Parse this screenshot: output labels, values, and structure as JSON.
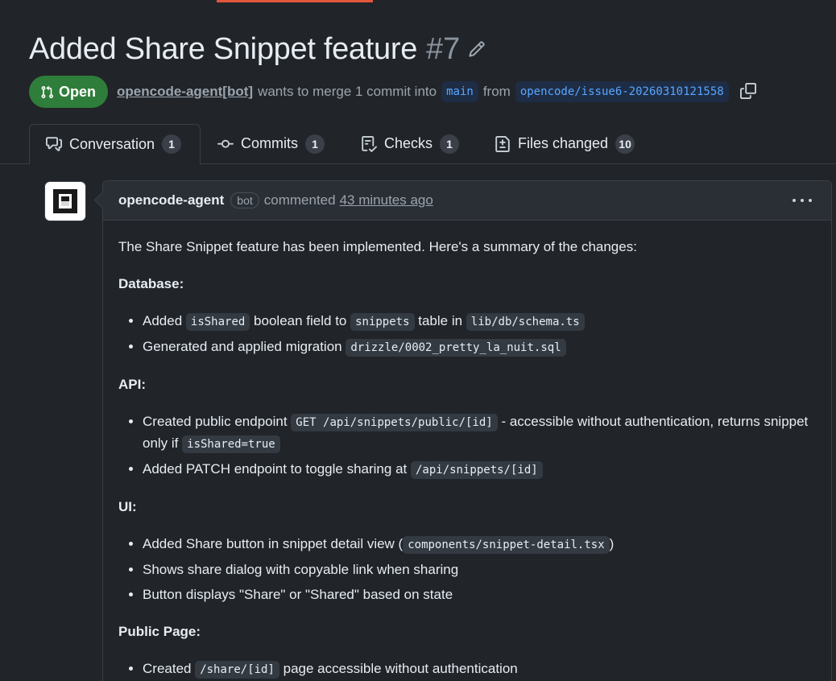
{
  "pr": {
    "title": "Added Share Snippet feature",
    "number": "#7",
    "state": "Open",
    "author": "opencode-agent[bot]",
    "merge_text": "wants to merge 1 commit into",
    "base_branch": "main",
    "from_text": "from",
    "head_branch": "opencode/issue6-20260310121558"
  },
  "tabs": [
    {
      "label": "Conversation",
      "count": "1",
      "icon": "comment-discussion-icon"
    },
    {
      "label": "Commits",
      "count": "1",
      "icon": "git-commit-icon"
    },
    {
      "label": "Checks",
      "count": "1",
      "icon": "checklist-icon"
    },
    {
      "label": "Files changed",
      "count": "10",
      "icon": "file-diff-icon"
    }
  ],
  "comment": {
    "author": "opencode-agent",
    "badge": "bot",
    "verb": "commented",
    "time": "43 minutes ago",
    "intro": "The Share Snippet feature has been implemented. Here's a summary of the changes:",
    "database": {
      "heading": "Database:",
      "item1": {
        "t1": "Added ",
        "c1": "isShared",
        "t2": " boolean field to ",
        "c2": "snippets",
        "t3": " table in ",
        "c3": "lib/db/schema.ts"
      },
      "item2": {
        "t1": "Generated and applied migration ",
        "c1": "drizzle/0002_pretty_la_nuit.sql"
      }
    },
    "api": {
      "heading": "API:",
      "item1": {
        "t1": "Created public endpoint ",
        "c1": "GET /api/snippets/public/[id]",
        "t2": " - accessible without authentication, returns snippet only if ",
        "c2": "isShared=true"
      },
      "item2": {
        "t1": "Added PATCH endpoint to toggle sharing at ",
        "c1": "/api/snippets/[id]"
      }
    },
    "ui": {
      "heading": "UI:",
      "item1": {
        "t1": "Added Share button in snippet detail view (",
        "c1": "components/snippet-detail.tsx",
        "t2": ")"
      },
      "item2": "Shows share dialog with copyable link when sharing",
      "item3": "Button displays \"Share\" or \"Shared\" based on state"
    },
    "public_page": {
      "heading": "Public Page:",
      "item1": {
        "t1": "Created ",
        "c1": "/share/[id]",
        "t2": " page accessible without authentication"
      }
    }
  },
  "colors": {
    "background": "#212429",
    "open_badge": "#2f7d3a",
    "branch_text": "#58a6ff",
    "accent_bar": "#e2563e"
  }
}
